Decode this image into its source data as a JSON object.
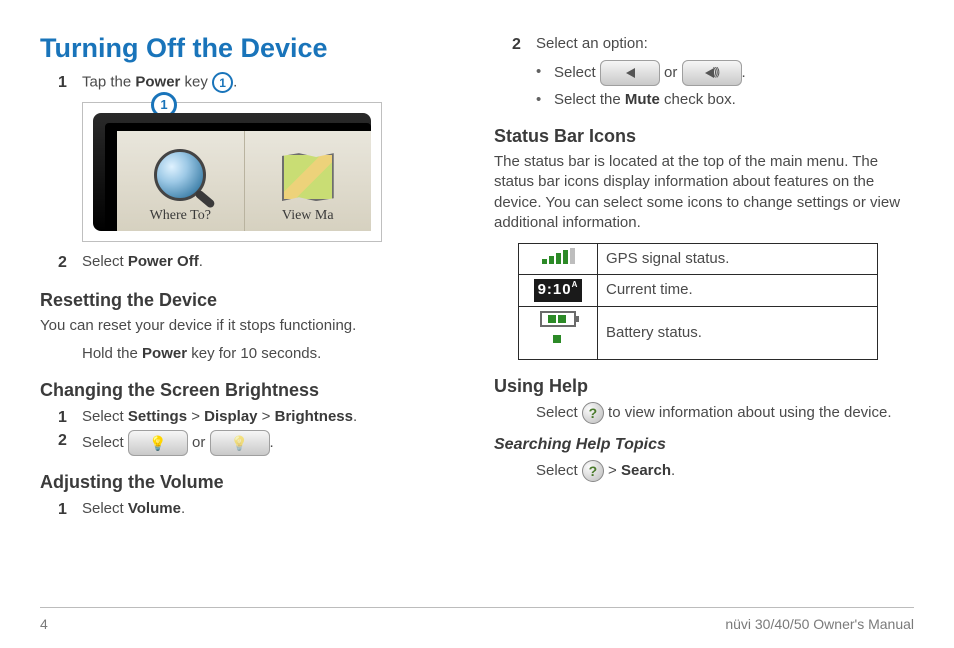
{
  "left": {
    "title": "Turning Off the Device",
    "step1_pre": "Tap the ",
    "step1_key": "Power",
    "step1_post": " key ",
    "callout": "1",
    "device": {
      "whereto": "Where To?",
      "viewmap": "View Ma"
    },
    "step2_pre": "Select ",
    "step2_bold": "Power Off",
    "resetting_h": "Resetting the Device",
    "resetting_body": "You can reset your device if it stops functioning.",
    "resetting_instr_pre": "Hold the ",
    "resetting_instr_bold": "Power",
    "resetting_instr_post": " key for 10 seconds.",
    "bright_h": "Changing the Screen Brightness",
    "bright1_pre": "Select ",
    "bright1_a": "Settings",
    "bright1_b": "Display",
    "bright1_c": "Brightness",
    "bright2_pre": "Select ",
    "bright2_or": " or ",
    "vol_h": "Adjusting the Volume",
    "vol1_pre": "Select ",
    "vol1_bold": "Volume"
  },
  "right": {
    "step2_lead": "Select an option:",
    "opt1_pre": "Select ",
    "opt1_or": " or ",
    "opt2_pre": "Select the ",
    "opt2_bold": "Mute",
    "opt2_post": " check box.",
    "status_h": "Status Bar Icons",
    "status_body": "The status bar is located at the top of the main menu. The status bar icons display information about features on the device. You can select some icons to change settings or view additional information.",
    "tbl": {
      "gps": "GPS signal status.",
      "time": "Current time.",
      "time_value": "9:10",
      "batt": "Battery status."
    },
    "help_h": "Using Help",
    "help_pre": "Select ",
    "help_post": " to view information about using the device.",
    "search_h": "Searching Help Topics",
    "search_pre": "Select ",
    "search_gt": " > ",
    "search_bold": "Search"
  },
  "footer": {
    "page": "4",
    "title": "nüvi 30/40/50 Owner's Manual"
  },
  "nums": {
    "one": "1",
    "two": "2"
  },
  "punct": {
    "period": ".",
    "gt": " > ",
    "qmark": "?"
  }
}
